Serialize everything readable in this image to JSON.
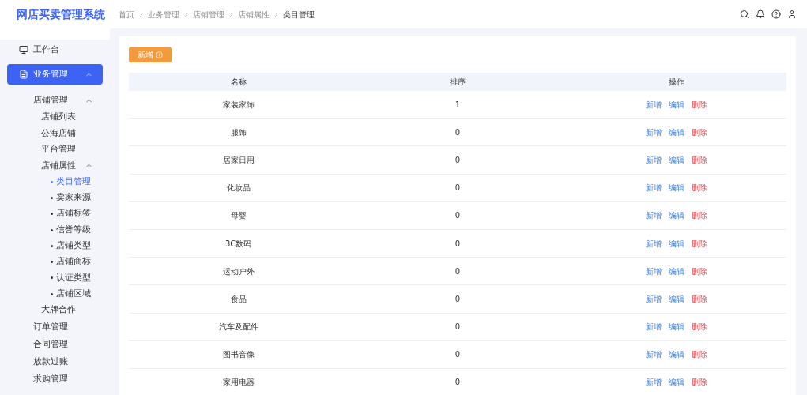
{
  "header": {
    "title": "网店买卖管理系统",
    "breadcrumbs": [
      "首页",
      "业务管理",
      "店铺管理",
      "店铺属性",
      "类目管理"
    ]
  },
  "sidebar": {
    "items": [
      {
        "label": "工作台",
        "selected": false
      },
      {
        "label": "业务管理",
        "selected": true,
        "expanded": true,
        "children": [
          {
            "label": "店铺管理",
            "selected": false,
            "expanded": true,
            "children": [
              {
                "label": "店铺列表",
                "selected": false
              },
              {
                "label": "公海店铺",
                "selected": false
              },
              {
                "label": "平台管理",
                "selected": false
              },
              {
                "label": "店铺属性",
                "selected": false,
                "expanded": true,
                "children": [
                  {
                    "label": "类目管理",
                    "selected": true
                  },
                  {
                    "label": "卖家来源",
                    "selected": false
                  },
                  {
                    "label": "店铺标签",
                    "selected": false
                  },
                  {
                    "label": "信誉等级",
                    "selected": false
                  },
                  {
                    "label": "店铺类型",
                    "selected": false
                  },
                  {
                    "label": "店铺商标",
                    "selected": false
                  },
                  {
                    "label": "认证类型",
                    "selected": false
                  },
                  {
                    "label": "店铺区域",
                    "selected": false
                  }
                ]
              },
              {
                "label": "大牌合作",
                "selected": false
              }
            ]
          },
          {
            "label": "订单管理",
            "selected": false
          },
          {
            "label": "合同管理",
            "selected": false
          },
          {
            "label": "放款过账",
            "selected": false
          },
          {
            "label": "求购管理",
            "selected": false
          }
        ]
      }
    ]
  },
  "toolbar": {
    "add_button": "新增"
  },
  "table": {
    "columns": [
      "名称",
      "排序",
      "操作"
    ],
    "rows": [
      {
        "name": "家装家饰",
        "sort": "1",
        "actions": [
          {
            "label": "新增",
            "kind": "add"
          },
          {
            "label": "编辑",
            "kind": "edit"
          },
          {
            "label": "删除",
            "kind": "delete"
          }
        ]
      },
      {
        "name": "服饰",
        "sort": "0",
        "actions": [
          {
            "label": "新增",
            "kind": "add"
          },
          {
            "label": "编辑",
            "kind": "edit"
          },
          {
            "label": "删除",
            "kind": "delete"
          }
        ]
      },
      {
        "name": "居家日用",
        "sort": "0",
        "actions": [
          {
            "label": "新增",
            "kind": "add"
          },
          {
            "label": "编辑",
            "kind": "edit"
          },
          {
            "label": "删除",
            "kind": "delete"
          }
        ]
      },
      {
        "name": "化妆品",
        "sort": "0",
        "actions": [
          {
            "label": "新增",
            "kind": "add"
          },
          {
            "label": "编辑",
            "kind": "edit"
          },
          {
            "label": "删除",
            "kind": "delete"
          }
        ]
      },
      {
        "name": "母婴",
        "sort": "0",
        "actions": [
          {
            "label": "新增",
            "kind": "add"
          },
          {
            "label": "编辑",
            "kind": "edit"
          },
          {
            "label": "删除",
            "kind": "delete"
          }
        ]
      },
      {
        "name": "3C数码",
        "sort": "0",
        "actions": [
          {
            "label": "新增",
            "kind": "add"
          },
          {
            "label": "编辑",
            "kind": "edit"
          },
          {
            "label": "删除",
            "kind": "delete"
          }
        ]
      },
      {
        "name": "运动户外",
        "sort": "0",
        "actions": [
          {
            "label": "新增",
            "kind": "add"
          },
          {
            "label": "编辑",
            "kind": "edit"
          },
          {
            "label": "删除",
            "kind": "delete"
          }
        ]
      },
      {
        "name": "食品",
        "sort": "0",
        "actions": [
          {
            "label": "新增",
            "kind": "add"
          },
          {
            "label": "编辑",
            "kind": "edit"
          },
          {
            "label": "删除",
            "kind": "delete"
          }
        ]
      },
      {
        "name": "汽车及配件",
        "sort": "0",
        "actions": [
          {
            "label": "新增",
            "kind": "add"
          },
          {
            "label": "编辑",
            "kind": "edit"
          },
          {
            "label": "删除",
            "kind": "delete"
          }
        ]
      },
      {
        "name": "图书音像",
        "sort": "0",
        "actions": [
          {
            "label": "新增",
            "kind": "add"
          },
          {
            "label": "编辑",
            "kind": "edit"
          },
          {
            "label": "删除",
            "kind": "delete"
          }
        ]
      },
      {
        "name": "家用电器",
        "sort": "0",
        "actions": [
          {
            "label": "新增",
            "kind": "add"
          },
          {
            "label": "编辑",
            "kind": "edit"
          },
          {
            "label": "删除",
            "kind": "delete"
          }
        ]
      }
    ]
  }
}
